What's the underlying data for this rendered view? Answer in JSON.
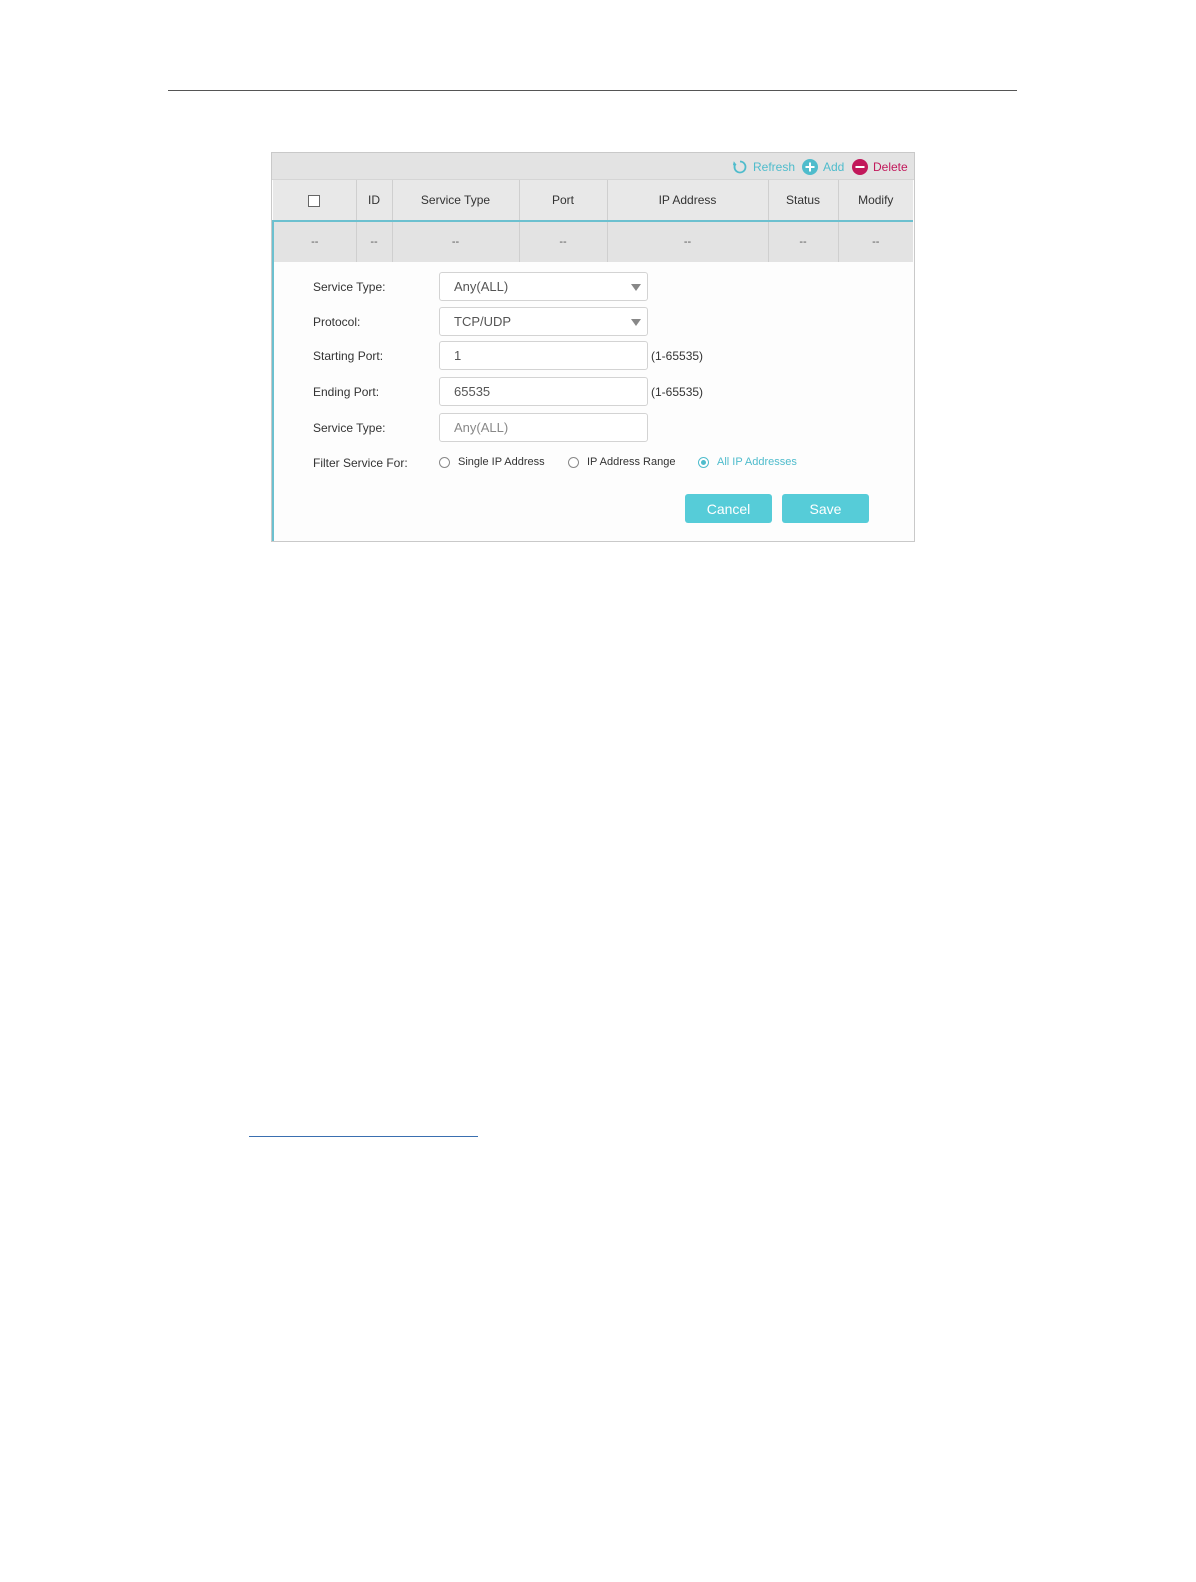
{
  "toolbar": {
    "refresh_label": "Refresh",
    "add_label": "Add",
    "delete_label": "Delete",
    "refresh_icon": "refresh-icon",
    "add_icon": "plus-circle-icon",
    "delete_icon": "minus-circle-icon"
  },
  "table": {
    "headers": [
      "",
      "ID",
      "Service Type",
      "Port",
      "IP Address",
      "Status",
      "Modify"
    ],
    "rows": [
      [
        "--",
        "--",
        "--",
        "--",
        "--",
        "--",
        "--"
      ]
    ]
  },
  "form": {
    "service_type_label": "Service Type:",
    "service_type_value": "Any(ALL)",
    "protocol_label": "Protocol:",
    "protocol_value": "TCP/UDP",
    "starting_port_label": "Starting Port:",
    "starting_port_value": "1",
    "starting_port_hint": "(1-65535)",
    "ending_port_label": "Ending Port:",
    "ending_port_value": "65535",
    "ending_port_hint": "(1-65535)",
    "service_type2_label": "Service Type:",
    "service_type2_value": "Any(ALL)",
    "filter_label": "Filter Service For:",
    "radio_single": "Single IP Address",
    "radio_range": "IP Address Range",
    "radio_all": "All IP Addresses",
    "selected_radio": "All IP Addresses",
    "cancel_label": "Cancel",
    "save_label": "Save"
  },
  "colors": {
    "accent": "#56ccd8",
    "delete": "#c2185b",
    "header_bg": "#e3e3e3"
  }
}
